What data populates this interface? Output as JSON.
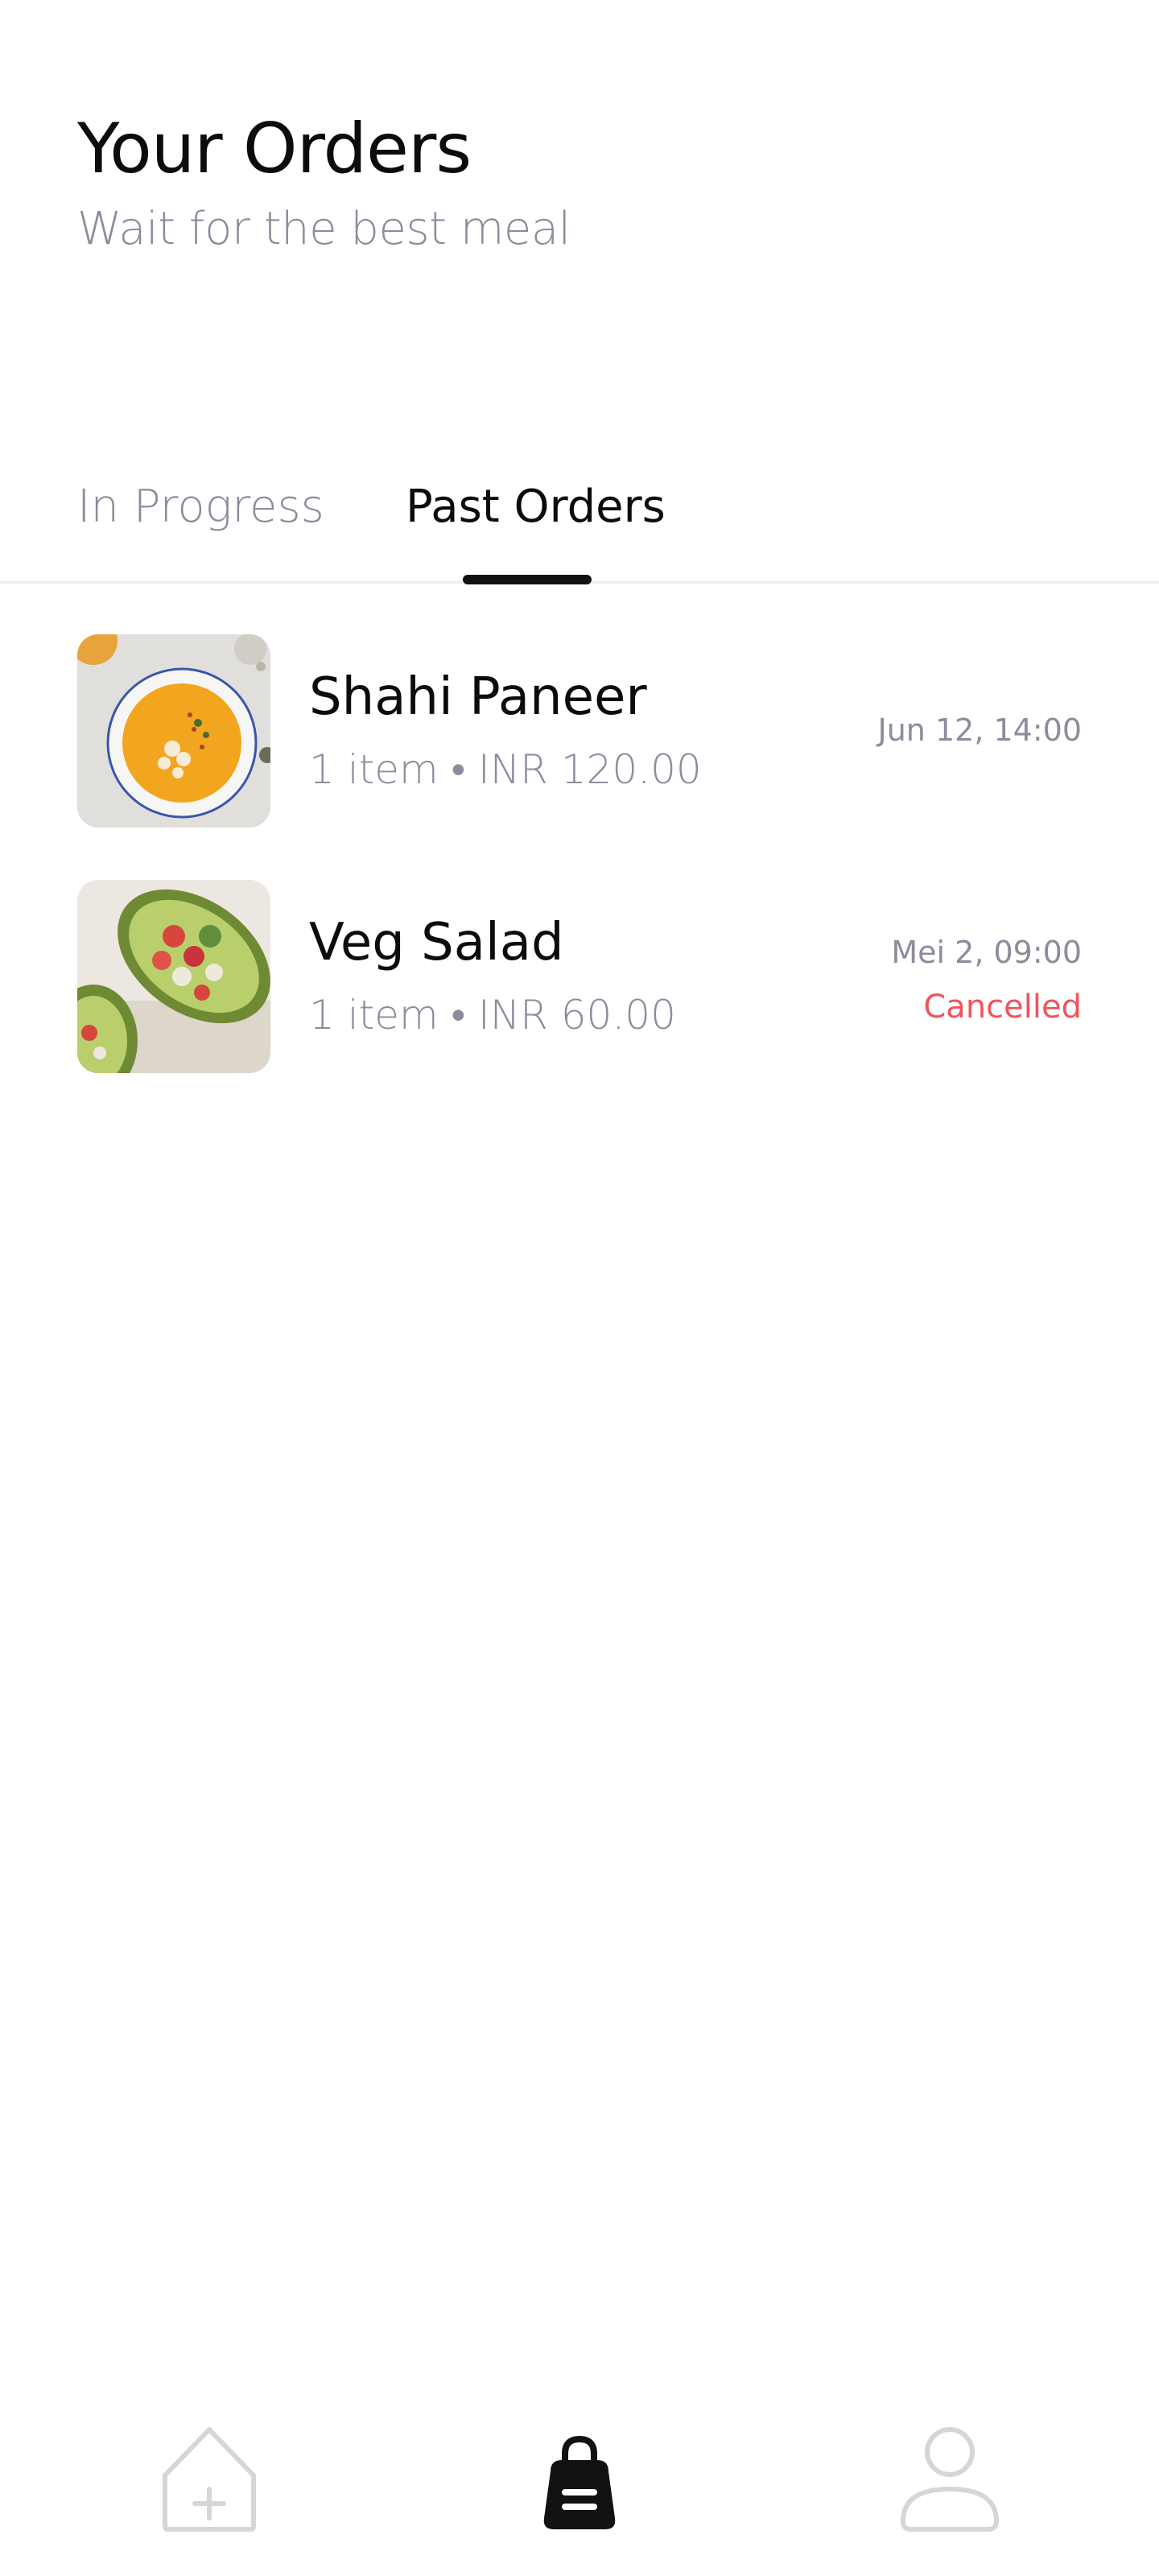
{
  "header": {
    "title": "Your Orders",
    "subtitle": "Wait for the best meal"
  },
  "tabs": [
    {
      "label": "In Progress",
      "active": false
    },
    {
      "label": "Past Orders",
      "active": true
    }
  ],
  "orders": [
    {
      "name": "Shahi Paneer",
      "meta": "1 item • INR 120.00",
      "date": "Jun 12, 14:00",
      "status": "",
      "image": "soup-bowl-image"
    },
    {
      "name": "Veg Salad",
      "meta": "1 item • INR 60.00",
      "date": "Mei 2, 09:00",
      "status": "Cancelled",
      "image": "avocado-salad-image"
    }
  ],
  "bottom_nav": [
    {
      "icon": "home-add-icon",
      "active": false
    },
    {
      "icon": "shopping-bag-icon",
      "active": true
    },
    {
      "icon": "profile-icon",
      "active": false
    }
  ],
  "colors": {
    "text_primary": "#0c0c0c",
    "text_secondary": "#8b8c9c",
    "status_cancelled": "#f0545c",
    "active_nav": "#111111",
    "inactive_nav": "#d6d6d6"
  }
}
